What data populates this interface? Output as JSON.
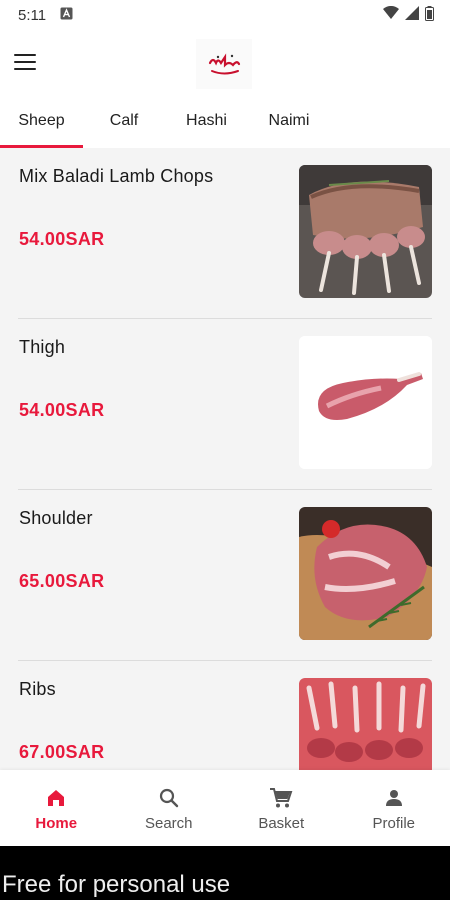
{
  "status_bar": {
    "time": "5:11",
    "notification_icon": "a-square-icon",
    "wifi_icon": "wifi-icon",
    "signal_icon": "signal-icon",
    "battery_icon": "battery-icon"
  },
  "app_bar": {
    "logo_icon": "brand-logo-icon",
    "menu_icon": "hamburger-menu-icon"
  },
  "tabs": [
    {
      "label": "Sheep",
      "active": true
    },
    {
      "label": "Calf",
      "active": false
    },
    {
      "label": "Hashi",
      "active": false
    },
    {
      "label": "Naimi",
      "active": false
    }
  ],
  "products": [
    {
      "name": "Mix Baladi Lamb Chops",
      "price": "54.00SAR",
      "image": "lamb-chops-photo"
    },
    {
      "name": "Thigh",
      "price": "54.00SAR",
      "image": "lamb-thigh-photo"
    },
    {
      "name": "Shoulder",
      "price": "65.00SAR",
      "image": "lamb-shoulder-photo"
    },
    {
      "name": "Ribs",
      "price": "67.00SAR",
      "image": "lamb-ribs-photo"
    }
  ],
  "bottom_nav": [
    {
      "label": "Home",
      "icon": "home-icon",
      "active": true
    },
    {
      "label": "Search",
      "icon": "search-icon",
      "active": false
    },
    {
      "label": "Basket",
      "icon": "cart-icon",
      "active": false
    },
    {
      "label": "Profile",
      "icon": "person-icon",
      "active": false
    }
  ],
  "watermark": "Free for personal use",
  "colors": {
    "accent": "#e8193c",
    "background": "#f4f4f4",
    "divider": "#dcdcdc"
  }
}
